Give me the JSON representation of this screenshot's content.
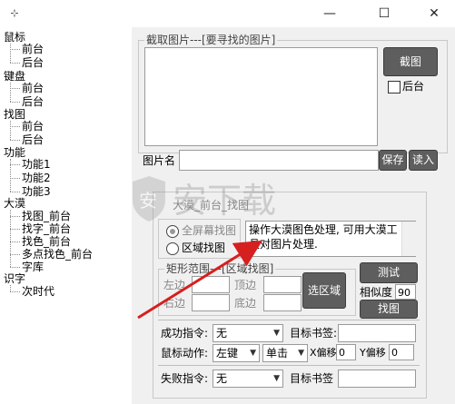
{
  "window": {
    "icon_glyph": "⊹",
    "minimize_glyph": "—",
    "maximize_glyph": "☐",
    "close_glyph": "✕"
  },
  "tree": {
    "nodes": [
      {
        "label": "鼠标",
        "children": [
          "前台",
          "后台"
        ]
      },
      {
        "label": "键盘",
        "children": [
          "前台",
          "后台"
        ]
      },
      {
        "label": "找图",
        "children": [
          "前台",
          "后台"
        ]
      },
      {
        "label": "功能",
        "children": [
          "功能1",
          "功能2",
          "功能3"
        ]
      },
      {
        "label": "大漠",
        "children": [
          "找图_前台",
          "找字_前台",
          "找色_前台",
          "多点找色_前台",
          "字库"
        ]
      },
      {
        "label": "识字",
        "children": [
          "次时代"
        ]
      }
    ]
  },
  "capture": {
    "group_title": "截取图片---[要寻找的图片]",
    "capture_button": "截图",
    "background_checkbox": "后台",
    "image_name_label": "图片名",
    "image_name_value": "",
    "save_button": "保存",
    "load_button": "读入"
  },
  "dm": {
    "header_title": "大漠_前台_找图",
    "radio_fullscreen": "全屏幕找图",
    "radio_region": "区域找图",
    "description": "操作大漠图色处理, 可用大漠工具对图片处理.",
    "rect_group_title": "矩形范围---[区域找图]",
    "left_label": "左边",
    "top_label": "顶边",
    "right_label": "右边",
    "bottom_label": "底边",
    "select_region_button": "选区域",
    "test_button": "测试",
    "similarity_label": "相似度",
    "similarity_value": "90",
    "find_button": "找图",
    "success_cmd_label": "成功指令:",
    "success_cmd_value": "无",
    "target_label_1": "目标书签:",
    "mouse_action_label": "鼠标动作:",
    "mouse_button_value": "左键",
    "click_type_value": "单击",
    "x_offset_label": "X偏移",
    "x_offset_value": "0",
    "y_offset_label": "Y偏移",
    "y_offset_value": "0",
    "fail_cmd_label": "失败指令:",
    "fail_cmd_value": "无",
    "target_label_2": "目标书签"
  },
  "watermark": {
    "text": "安下载",
    "sub": "anxz.com"
  },
  "colors": {
    "panel_bg": "#f0f0f0",
    "dark_button": "#5e5e5e",
    "arrow": "#d61f1f"
  }
}
